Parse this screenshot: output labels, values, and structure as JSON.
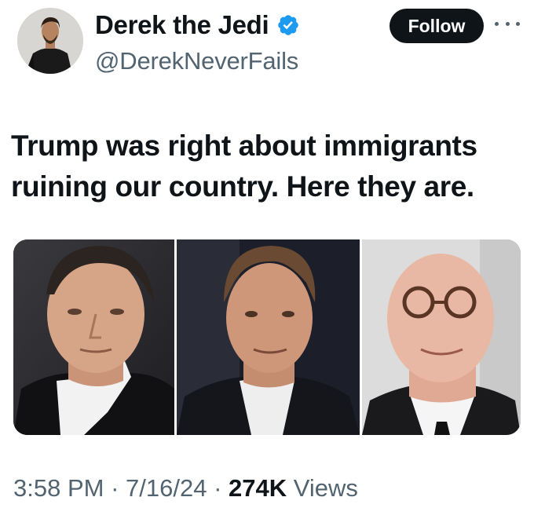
{
  "author": {
    "display_name": "Derek the Jedi",
    "handle": "@DerekNeverFails",
    "verified": true,
    "verified_icon": "verified-badge-icon",
    "avatar_icon": "profile-avatar"
  },
  "actions": {
    "follow_label": "Follow",
    "more_icon": "more-options-icon"
  },
  "tweet": {
    "text": "Trump was right about immigrants\nruining our country.  Here they are."
  },
  "media": {
    "panels": [
      "photo-1",
      "photo-2",
      "photo-3"
    ]
  },
  "meta": {
    "time": "3:58 PM",
    "separator": "·",
    "date": "7/16/24",
    "views_count": "274K",
    "views_label": "Views"
  },
  "colors": {
    "text_primary": "#0f1419",
    "text_secondary": "#536471",
    "verified_blue": "#1d9bf0",
    "follow_bg": "#0f1419"
  }
}
